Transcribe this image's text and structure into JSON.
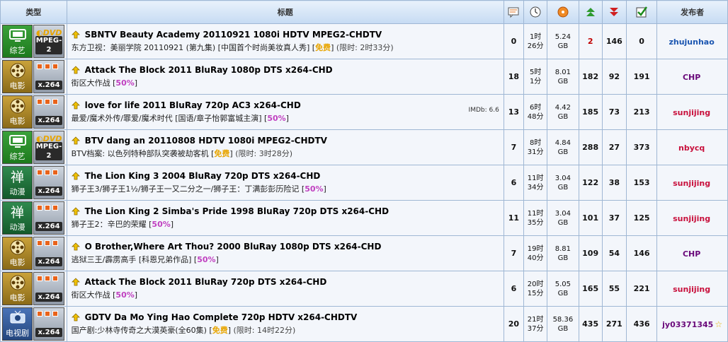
{
  "header": {
    "type": "类型",
    "title": "标题",
    "uploader": "发布者"
  },
  "colors": {
    "free": "#e8a500",
    "half": "#c040c0"
  },
  "rows": [
    {
      "category": "综艺",
      "category_icon": "tv-icon",
      "format": "MPEG-2",
      "format_style": "dvd",
      "name": "SBNTV Beauty Academy 20110921 1080i HDTV MPEG2-CHDTV",
      "desc": "东方卫视：美丽学院 20110921 (第九集) [中国首个时尚美妆真人秀]",
      "promo": "免费",
      "promo_kind": "free",
      "limit": "(限时: 2时33分)",
      "imdb": "",
      "comments": "0",
      "time": [
        "1时",
        "26分"
      ],
      "size": [
        "5.24",
        "GB"
      ],
      "seeders": "2",
      "leechers": "146",
      "completed": "0",
      "uploader": "zhujunhao",
      "uploader_color": "#1a55b0",
      "star": ""
    },
    {
      "category": "电影",
      "category_icon": "film-reel-icon",
      "format": "x.264",
      "format_style": "dots",
      "name": "Attack The Block 2011 BluRay 1080p DTS x264-CHD",
      "desc": "街区大作战",
      "promo": "50%",
      "promo_kind": "half",
      "limit": "",
      "imdb": "",
      "comments": "18",
      "time": [
        "5时",
        "1分"
      ],
      "size": [
        "8.01",
        "GB"
      ],
      "seeders": "182",
      "leechers": "92",
      "completed": "191",
      "uploader": "CHP",
      "uploader_color": "#6a0a7a",
      "star": ""
    },
    {
      "category": "电影",
      "category_icon": "film-reel-icon",
      "format": "x.264",
      "format_style": "dots",
      "name": "love for life 2011 BluRay 720p AC3 x264-CHD",
      "desc": "最爱/魔术外传/罪爱/魔术时代 [国语/章子怡郭富城主演]",
      "promo": "50%",
      "promo_kind": "half",
      "limit": "",
      "imdb": "IMDb: 6.6",
      "comments": "13",
      "time": [
        "6时",
        "48分"
      ],
      "size": [
        "4.42",
        "GB"
      ],
      "seeders": "185",
      "leechers": "73",
      "completed": "213",
      "uploader": "sunjijing",
      "uploader_color": "#c8103c",
      "star": ""
    },
    {
      "category": "综艺",
      "category_icon": "tv-icon",
      "format": "MPEG-2",
      "format_style": "dvd",
      "name": "BTV dang an 20110808 HDTV 1080i MPEG2-CHDTV",
      "desc": "BTV档案: 以色列特种部队突袭被劫客机",
      "promo": "免费",
      "promo_kind": "free",
      "limit": "(限时: 3时28分)",
      "imdb": "",
      "comments": "7",
      "time": [
        "8时",
        "31分"
      ],
      "size": [
        "4.84",
        "GB"
      ],
      "seeders": "288",
      "leechers": "27",
      "completed": "373",
      "uploader": "nbycq",
      "uploader_color": "#c8103c",
      "star": ""
    },
    {
      "category": "动漫",
      "category_icon": "zen-glyph-icon",
      "format": "x.264",
      "format_style": "dots",
      "name": "The Lion King 3 2004 BluRay 720p DTS x264-CHD",
      "desc": "狮子王3/狮子王1½/狮子王一又二分之一/狮子王：丁满彭彭历险记",
      "promo": "50%",
      "promo_kind": "half",
      "limit": "",
      "imdb": "",
      "comments": "6",
      "time": [
        "11时",
        "34分"
      ],
      "size": [
        "3.04",
        "GB"
      ],
      "seeders": "122",
      "leechers": "38",
      "completed": "153",
      "uploader": "sunjijing",
      "uploader_color": "#c8103c",
      "star": ""
    },
    {
      "category": "动漫",
      "category_icon": "zen-glyph-icon",
      "format": "x.264",
      "format_style": "dots",
      "name": "The Lion King 2 Simba's Pride 1998 BluRay 720p DTS x264-CHD",
      "desc": "狮子王2：辛巴的荣耀",
      "promo": "50%",
      "promo_kind": "half",
      "limit": "",
      "imdb": "",
      "comments": "11",
      "time": [
        "11时",
        "35分"
      ],
      "size": [
        "3.04",
        "GB"
      ],
      "seeders": "101",
      "leechers": "37",
      "completed": "125",
      "uploader": "sunjijing",
      "uploader_color": "#c8103c",
      "star": ""
    },
    {
      "category": "电影",
      "category_icon": "film-reel-icon",
      "format": "x.264",
      "format_style": "dots",
      "name": "O Brother,Where Art Thou? 2000 BluRay 1080p DTS x264-CHD",
      "desc": "逃狱三王/霹雳高手 [科恩兄弟作品]",
      "promo": "50%",
      "promo_kind": "half",
      "limit": "",
      "imdb": "",
      "comments": "7",
      "time": [
        "19时",
        "40分"
      ],
      "size": [
        "8.81",
        "GB"
      ],
      "seeders": "109",
      "leechers": "54",
      "completed": "146",
      "uploader": "CHP",
      "uploader_color": "#6a0a7a",
      "star": ""
    },
    {
      "category": "电影",
      "category_icon": "film-reel-icon",
      "format": "x.264",
      "format_style": "dots",
      "name": "Attack The Block 2011 BluRay 720p DTS x264-CHD",
      "desc": "街区大作战",
      "promo": "50%",
      "promo_kind": "half",
      "limit": "",
      "imdb": "",
      "comments": "6",
      "time": [
        "20时",
        "15分"
      ],
      "size": [
        "5.05",
        "GB"
      ],
      "seeders": "165",
      "leechers": "55",
      "completed": "221",
      "uploader": "sunjijing",
      "uploader_color": "#c8103c",
      "star": ""
    },
    {
      "category": "电视剧",
      "category_icon": "tv-drama-icon",
      "format": "x.264",
      "format_style": "dots",
      "name": "GDTV Da Mo Ying Hao Complete 720p HDTV x264-CHDTV",
      "desc": "国产剧:少林寺传奇之大漠英豪(全60集)",
      "promo": "免费",
      "promo_kind": "free",
      "limit": "(限时: 14时22分)",
      "imdb": "",
      "comments": "20",
      "time": [
        "21时",
        "37分"
      ],
      "size": [
        "58.36",
        "GB"
      ],
      "seeders": "435",
      "leechers": "271",
      "completed": "436",
      "uploader": "jy03371345",
      "uploader_color": "#6a0a7a",
      "star": "☆"
    }
  ]
}
